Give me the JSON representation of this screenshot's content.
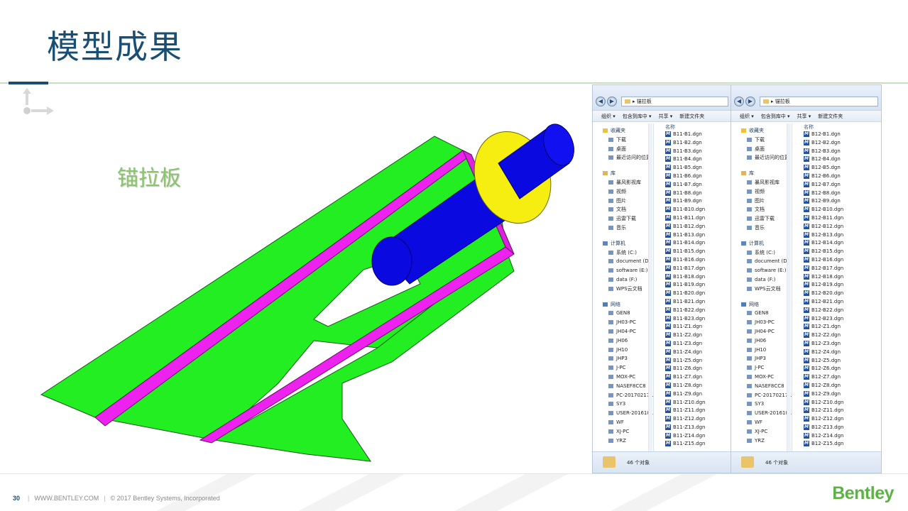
{
  "slide": {
    "title": "模型成果",
    "model_label": "锚拉板"
  },
  "explorers": [
    {
      "path": "锚拉板",
      "toolbar": [
        "组织 ▾",
        "包含到库中 ▾",
        "共享 ▾",
        "新建文件夹"
      ],
      "nav": [
        {
          "head": "收藏夹",
          "icon": "star-icon",
          "items": [
            "下载",
            "桌面",
            "最近访问的位置"
          ]
        },
        {
          "head": "库",
          "icon": "library-icon",
          "items": [
            "暴风影视库",
            "视频",
            "图片",
            "文档",
            "迅雷下载",
            "音乐"
          ]
        },
        {
          "head": "计算机",
          "icon": "computer-icon",
          "items": [
            "系统 (C:)",
            "document (D:)",
            "software (E:)",
            "data (F:)",
            "WPS云文档"
          ]
        },
        {
          "head": "网络",
          "icon": "network-icon",
          "items": [
            "GEN8",
            "JH03-PC",
            "JH04-PC",
            "JH06",
            "JH10",
            "JHP3",
            "J-PC",
            "MOX-PC",
            "NASEF8CC8",
            "PC-20170217ILI",
            "SY3",
            "USER-20161013",
            "WF",
            "XJ-PC",
            "YRZ"
          ]
        }
      ],
      "column_header": "名称",
      "files": [
        "B11-B1.dgn",
        "B11-B2.dgn",
        "B11-B3.dgn",
        "B11-B4.dgn",
        "B11-B5.dgn",
        "B11-B6.dgn",
        "B11-B7.dgn",
        "B11-B8.dgn",
        "B11-B9.dgn",
        "B11-B10.dgn",
        "B11-B11.dgn",
        "B11-B12.dgn",
        "B11-B13.dgn",
        "B11-B14.dgn",
        "B11-B15.dgn",
        "B11-B16.dgn",
        "B11-B17.dgn",
        "B11-B18.dgn",
        "B11-B19.dgn",
        "B11-B20.dgn",
        "B11-B21.dgn",
        "B11-B22.dgn",
        "B11-B23.dgn",
        "B11-Z1.dgn",
        "B11-Z2.dgn",
        "B11-Z3.dgn",
        "B11-Z4.dgn",
        "B11-Z5.dgn",
        "B11-Z6.dgn",
        "B11-Z7.dgn",
        "B11-Z8.dgn",
        "B11-Z9.dgn",
        "B11-Z10.dgn",
        "B11-Z11.dgn",
        "B11-Z12.dgn",
        "B11-Z13.dgn",
        "B11-Z14.dgn",
        "B11-Z15.dgn"
      ],
      "status": "46 个对象"
    },
    {
      "path": "锚拉板",
      "toolbar": [
        "组织 ▾",
        "包含到库中 ▾",
        "共享 ▾",
        "新建文件夹"
      ],
      "nav": [
        {
          "head": "收藏夹",
          "icon": "star-icon",
          "items": [
            "下载",
            "桌面",
            "最近访问的位置"
          ]
        },
        {
          "head": "库",
          "icon": "library-icon",
          "items": [
            "暴风影视库",
            "视频",
            "图片",
            "文档",
            "迅雷下载",
            "音乐"
          ]
        },
        {
          "head": "计算机",
          "icon": "computer-icon",
          "items": [
            "系统 (C:)",
            "document (D:)",
            "software (E:)",
            "data (F:)",
            "WPS云文档"
          ]
        },
        {
          "head": "网络",
          "icon": "network-icon",
          "items": [
            "GEN8",
            "JH03-PC",
            "JH04-PC",
            "JH06",
            "JH10",
            "JHP3",
            "J-PC",
            "MOX-PC",
            "NASEF8CC8",
            "PC-20170217ILI",
            "SY3",
            "USER-20161013",
            "WF",
            "XJ-PC",
            "YRZ"
          ]
        }
      ],
      "column_header": "名称",
      "files": [
        "B12-B1.dgn",
        "B12-B2.dgn",
        "B12-B3.dgn",
        "B12-B4.dgn",
        "B12-B5.dgn",
        "B12-B6.dgn",
        "B12-B7.dgn",
        "B12-B8.dgn",
        "B12-B9.dgn",
        "B12-B10.dgn",
        "B12-B11.dgn",
        "B12-B12.dgn",
        "B12-B13.dgn",
        "B12-B14.dgn",
        "B12-B15.dgn",
        "B12-B16.dgn",
        "B12-B17.dgn",
        "B12-B18.dgn",
        "B12-B19.dgn",
        "B12-B20.dgn",
        "B12-B21.dgn",
        "B12-B22.dgn",
        "B12-B23.dgn",
        "B12-Z1.dgn",
        "B12-Z2.dgn",
        "B12-Z3.dgn",
        "B12-Z4.dgn",
        "B12-Z5.dgn",
        "B12-Z6.dgn",
        "B12-Z7.dgn",
        "B12-Z8.dgn",
        "B12-Z9.dgn",
        "B12-Z10.dgn",
        "B12-Z11.dgn",
        "B12-Z12.dgn",
        "B12-Z13.dgn",
        "B12-Z14.dgn",
        "B12-Z15.dgn"
      ],
      "status": "46 个对象"
    }
  ],
  "footer": {
    "page": "30",
    "website": "WWW.BENTLEY.COM",
    "copyright": "© 2017 Bentley Systems, Incorporated",
    "brand": "Bentley"
  },
  "colors": {
    "title": "#1a4e72",
    "plate": "#22ee22",
    "flange": "#ee22ee",
    "pin": "#0a0ae0",
    "washer": "#f5ee10",
    "brand": "#5db244"
  }
}
